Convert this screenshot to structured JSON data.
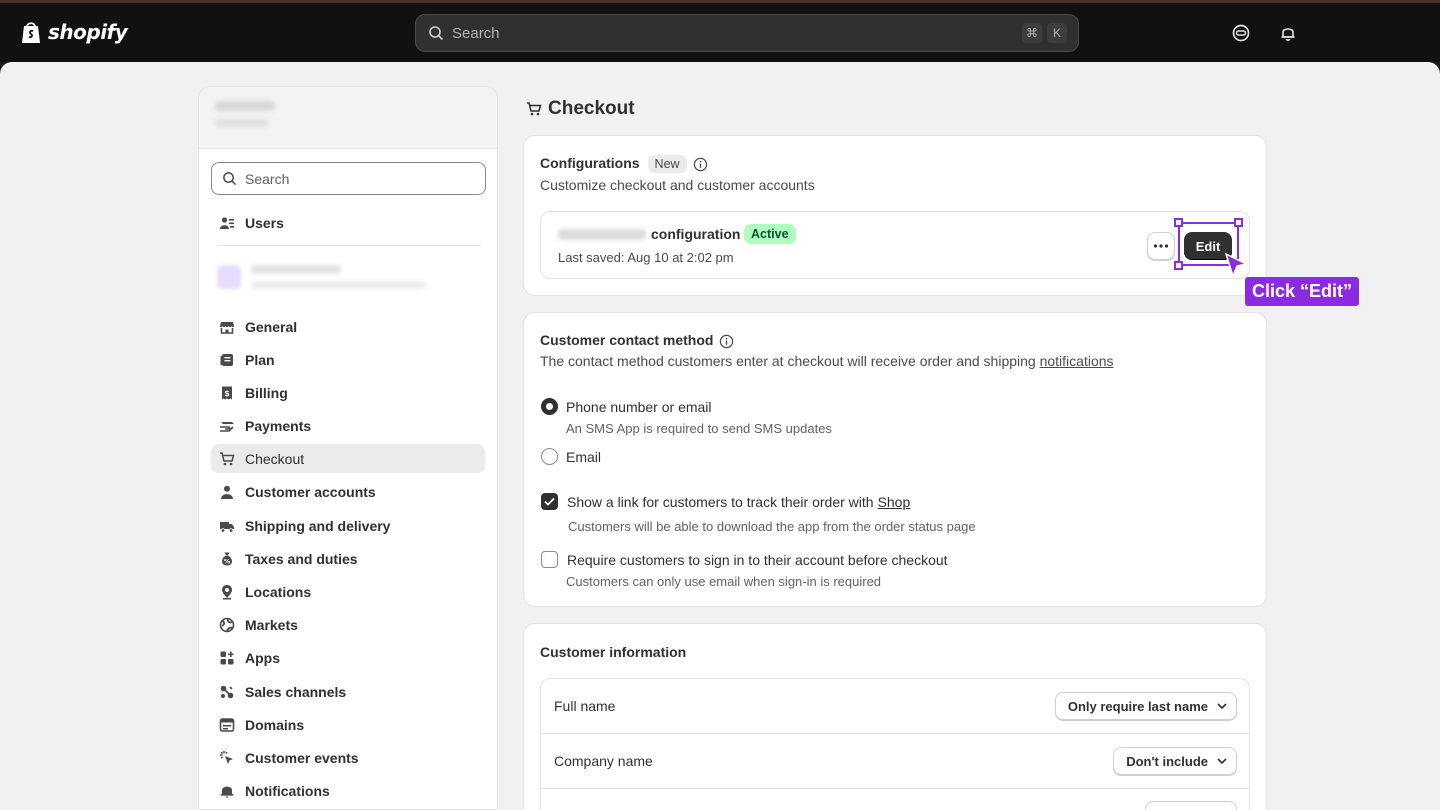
{
  "topbar": {
    "brand": "shopify",
    "search_placeholder": "Search",
    "shortcut_cmd": "⌘",
    "shortcut_key": "K"
  },
  "sidebar": {
    "search_placeholder": "Search",
    "users_label": "Users",
    "items": [
      {
        "label": "General",
        "icon": "store-icon"
      },
      {
        "label": "Plan",
        "icon": "plan-icon"
      },
      {
        "label": "Billing",
        "icon": "billing-icon"
      },
      {
        "label": "Payments",
        "icon": "payments-icon"
      },
      {
        "label": "Checkout",
        "icon": "cart-icon",
        "active": true
      },
      {
        "label": "Customer accounts",
        "icon": "person-icon"
      },
      {
        "label": "Shipping and delivery",
        "icon": "truck-icon"
      },
      {
        "label": "Taxes and duties",
        "icon": "tax-icon"
      },
      {
        "label": "Locations",
        "icon": "location-icon"
      },
      {
        "label": "Markets",
        "icon": "globe-icon"
      },
      {
        "label": "Apps",
        "icon": "apps-icon"
      },
      {
        "label": "Sales channels",
        "icon": "channels-icon"
      },
      {
        "label": "Domains",
        "icon": "domains-icon"
      },
      {
        "label": "Customer events",
        "icon": "events-icon"
      },
      {
        "label": "Notifications",
        "icon": "bell-icon"
      }
    ]
  },
  "page": {
    "title": "Checkout"
  },
  "configurations": {
    "title": "Configurations",
    "badge": "New",
    "subtitle": "Customize checkout and customer accounts",
    "config_name": "configuration",
    "status": "Active",
    "last_saved": "Last saved: Aug 10 at 2:02 pm",
    "edit_label": "Edit"
  },
  "annotation": {
    "tooltip": "Click “Edit”"
  },
  "contact": {
    "title": "Customer contact method",
    "subtitle_pre": "The contact method customers enter at checkout will receive order and shipping ",
    "subtitle_link": "notifications",
    "option1": "Phone number or email",
    "option1_help": "An SMS App is required to send SMS updates",
    "option2": "Email",
    "check1_pre": "Show a link for customers to track their order with ",
    "check1_link": "Shop",
    "check1_help": "Customers will be able to download the app from the order status page",
    "check2": "Require customers to sign in to their account before checkout",
    "check2_help": "Customers can only use email when sign-in is required"
  },
  "customer_info": {
    "title": "Customer information",
    "rows": [
      {
        "label": "Full name",
        "value": "Only require last name"
      },
      {
        "label": "Company name",
        "value": "Don't include"
      }
    ]
  },
  "colors": {
    "accent_annotation": "#8a2be2",
    "active_badge_bg": "#affebf",
    "topbar_bg": "#111111"
  }
}
